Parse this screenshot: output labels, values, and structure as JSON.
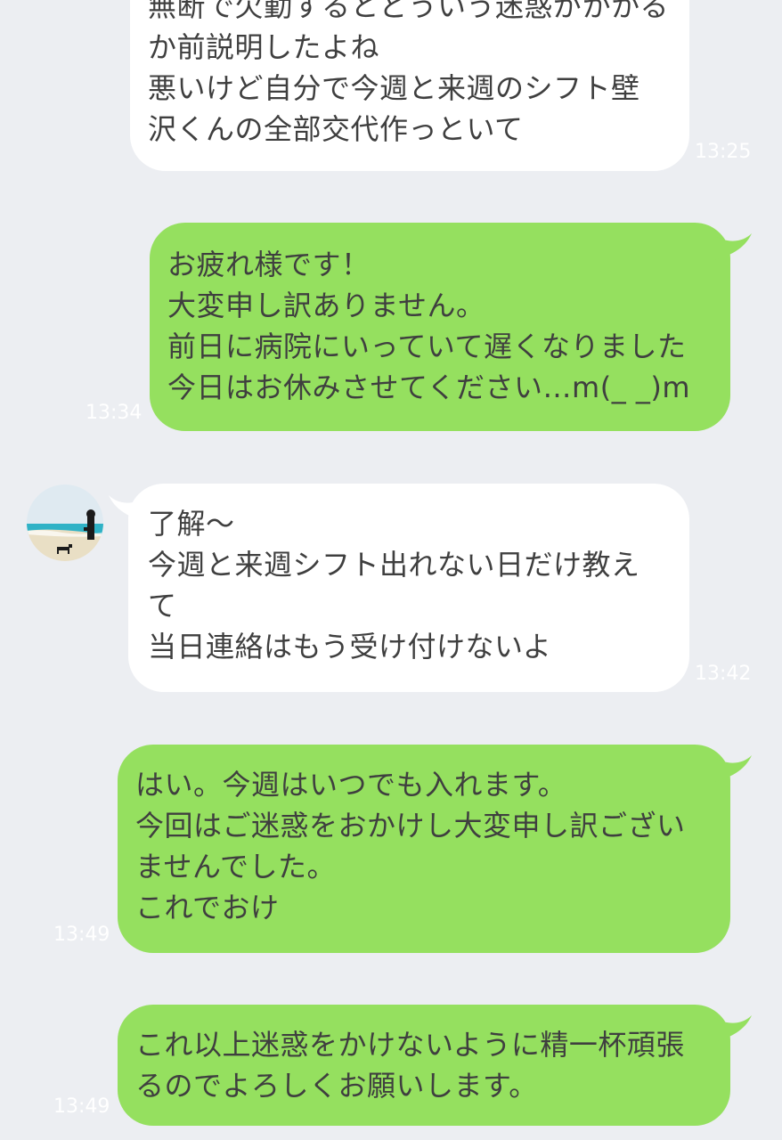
{
  "messages": [
    {
      "id": "m1",
      "direction": "incoming",
      "lines": [
        "無断で欠勤するとどういう迷惑がかかる",
        "か前説明したよね",
        "悪いけど自分で今週と来週のシフト壁",
        "沢くんの全部交代作っといて"
      ],
      "time": "13:25"
    },
    {
      "id": "m2",
      "direction": "outgoing",
      "lines": [
        "お疲れ様です！",
        "大変申し訳ありません。",
        "前日に病院にいっていて遅くなりました",
        "今日はお休みさせてください…m(_ _)m"
      ],
      "time": "13:34"
    },
    {
      "id": "m3",
      "direction": "incoming",
      "lines": [
        "了解〜",
        "今週と来週シフト出れない日だけ教え",
        "て",
        "当日連絡はもう受け付けないよ"
      ],
      "time": "13:42"
    },
    {
      "id": "m4",
      "direction": "outgoing",
      "lines": [
        "はい。今週はいつでも入れます。",
        "今回はご迷惑をおかけし大変申し訳ござい",
        "ませんでした。",
        "これでおけ"
      ],
      "time": "13:49"
    },
    {
      "id": "m5",
      "direction": "outgoing",
      "lines": [
        "これ以上迷惑をかけないように精一杯頑張",
        "るのでよろしくお願いします。"
      ],
      "time": "13:49"
    }
  ],
  "colors": {
    "background": "#eceef2",
    "incoming_bubble": "#ffffff",
    "outgoing_bubble": "#95e05f",
    "text": "#3f3f3f",
    "timestamp": "#ffffff"
  },
  "icons": {
    "avatar": "contact-avatar-beach-photo"
  }
}
